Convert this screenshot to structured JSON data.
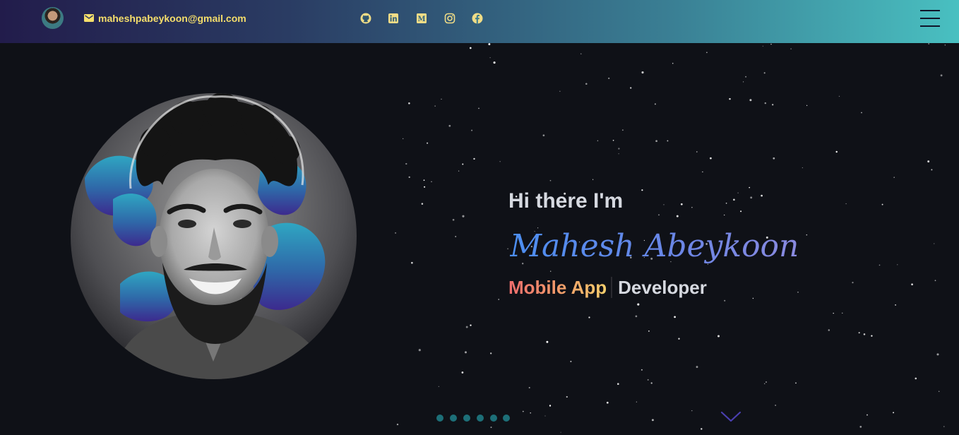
{
  "header": {
    "email": "maheshpabeykoon@gmail.com",
    "avatar_icon": "profile-avatar",
    "email_icon": "envelope-icon",
    "social_links": [
      {
        "icon": "github-icon"
      },
      {
        "icon": "linkedin-icon"
      },
      {
        "icon": "medium-icon"
      },
      {
        "icon": "instagram-icon"
      },
      {
        "icon": "facebook-icon"
      }
    ],
    "menu_icon": "hamburger-menu-icon"
  },
  "hero": {
    "greeting": "Hi there I'm",
    "name": "Mahesh Abeykoon",
    "role_typed": "Mobile App",
    "role_static": "Developer"
  },
  "pagination": {
    "count": 6
  },
  "colors": {
    "email_text": "#f5de6b",
    "background": "#0f1117",
    "name_gradient_start": "#4c8ef0",
    "name_gradient_end": "#8a8adf",
    "role_gradient_start": "#ef6d6d",
    "role_gradient_end": "#f5cf6c",
    "pagination_dot": "#1d6f78",
    "scroll_chevron": "#4a3fb0"
  }
}
